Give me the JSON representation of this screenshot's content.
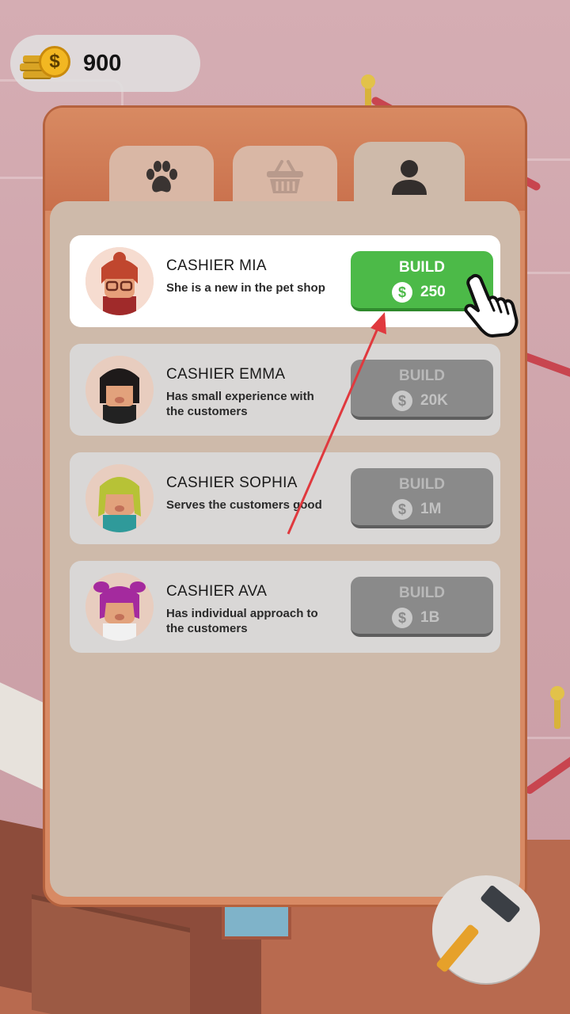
{
  "coins": {
    "value": "900",
    "symbol": "$"
  },
  "tabs": [
    {
      "icon": "paw-icon",
      "active": false
    },
    {
      "icon": "basket-icon",
      "active": false
    },
    {
      "icon": "person-icon",
      "active": true
    }
  ],
  "cashiers": [
    {
      "name": "CASHIER MIA",
      "description": "She is a new in the pet shop",
      "button_label": "BUILD",
      "price": "250",
      "currency_symbol": "$",
      "available": true
    },
    {
      "name": "CASHIER EMMA",
      "description": "Has small experience with the customers",
      "button_label": "BUILD",
      "price": "20K",
      "currency_symbol": "$",
      "available": false
    },
    {
      "name": "CASHIER SOPHIA",
      "description": "Serves the customers good",
      "button_label": "BUILD",
      "price": "1M",
      "currency_symbol": "$",
      "available": false
    },
    {
      "name": "CASHIER AVA",
      "description": "Has individual approach to the customers",
      "button_label": "BUILD",
      "price": "1B",
      "currency_symbol": "$",
      "available": false
    }
  ],
  "colors": {
    "panel_orange": "#d88a64",
    "panel_body": "#cebaaa",
    "build_green": "#4cba48",
    "build_disabled": "#8a8a8a",
    "tutorial_arrow": "#e0393e"
  },
  "tutorial": {
    "pointer_icon": "hand-pointer-icon",
    "arrow_icon": "tutorial-arrow-icon"
  },
  "tools": {
    "icon": "hammer-icon"
  }
}
